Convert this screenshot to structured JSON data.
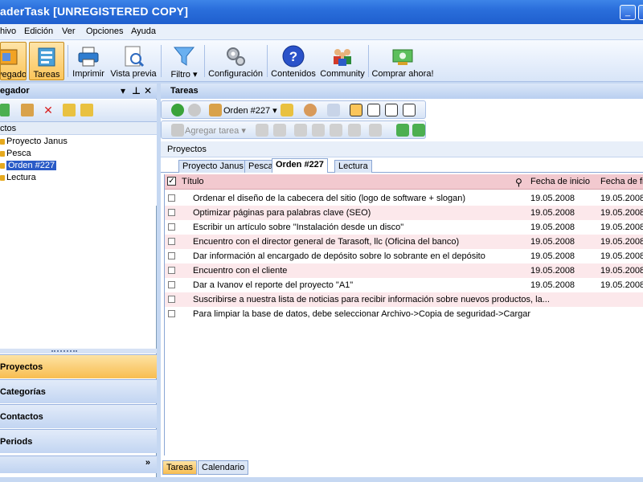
{
  "window": {
    "title": "aderTask [UNREGISTERED COPY]"
  },
  "menu": [
    "hivo",
    "Edición",
    "Ver",
    "Opciones",
    "Ayuda"
  ],
  "toolbar": [
    {
      "label": "vegador",
      "icon": "navigator-icon"
    },
    {
      "label": "Tareas",
      "icon": "tasks-icon"
    },
    {
      "label": "Imprimir",
      "icon": "printer-icon"
    },
    {
      "label": "Vista previa",
      "icon": "preview-icon"
    },
    {
      "label": "Filtro ▾",
      "icon": "filter-icon"
    },
    {
      "label": "Configuración",
      "icon": "gears-icon"
    },
    {
      "label": "Contenidos",
      "icon": "help-icon"
    },
    {
      "label": "Community",
      "icon": "community-icon"
    },
    {
      "label": "Comprar ahora!",
      "icon": "buy-icon"
    }
  ],
  "left": {
    "title": "egador",
    "tree_header": "ctos",
    "tree": [
      {
        "label": "Proyecto Janus"
      },
      {
        "label": "Pesca"
      },
      {
        "label": "Orden #227",
        "selected": true
      },
      {
        "label": "Lectura"
      }
    ],
    "nav": [
      "Proyectos",
      "Categorías",
      "Contactos",
      "Periods"
    ],
    "nav_more": "»"
  },
  "right": {
    "title": "Tareas",
    "toolbar1": {
      "order_label": "Orden #227 ▾"
    },
    "toolbar2": {
      "add_label": "Agregar tarea ▾"
    },
    "crumb": "Proyectos",
    "tabs": [
      "Proyecto Janus",
      "Pesca",
      "Orden #227",
      "Lectura"
    ],
    "active_tab": 2,
    "columns": {
      "title": "Título",
      "start": "Fecha de inicio",
      "end": "Fecha de fin"
    },
    "rows": [
      {
        "title": "Ordenar el diseño de la cabecera del sitio (logo de software + slogan)",
        "start": "19.05.2008",
        "end": "19.05.2008"
      },
      {
        "title": "Optimizar páginas para palabras clave (SEO)",
        "start": "19.05.2008",
        "end": "19.05.2008"
      },
      {
        "title": "Escribir un artículo sobre \"Instalación desde un disco\"",
        "start": "19.05.2008",
        "end": "19.05.2008"
      },
      {
        "title": "Encuentro con el director general de Tarasoft, llc (Oficina del banco)",
        "start": "19.05.2008",
        "end": "19.05.2008"
      },
      {
        "title": "Dar información al encargado de depósito sobre lo sobrante en el depósito",
        "start": "19.05.2008",
        "end": "19.05.2008"
      },
      {
        "title": "Encuentro con el cliente",
        "start": "19.05.2008",
        "end": "19.05.2008"
      },
      {
        "title": "Dar a Ivanov el reporte del proyecto \"A1\"",
        "start": "19.05.2008",
        "end": "19.05.2008"
      },
      {
        "title": "Suscribirse a nuestra lista de noticias para recibir información sobre nuevos productos, la...",
        "start": "",
        "end": ""
      },
      {
        "title": "Para limpiar la base de datos, debe seleccionar Archivo->Copia de seguridad->Cargar",
        "start": "",
        "end": ""
      }
    ],
    "bottom_tabs": [
      "Tareas",
      "Calendario"
    ]
  }
}
